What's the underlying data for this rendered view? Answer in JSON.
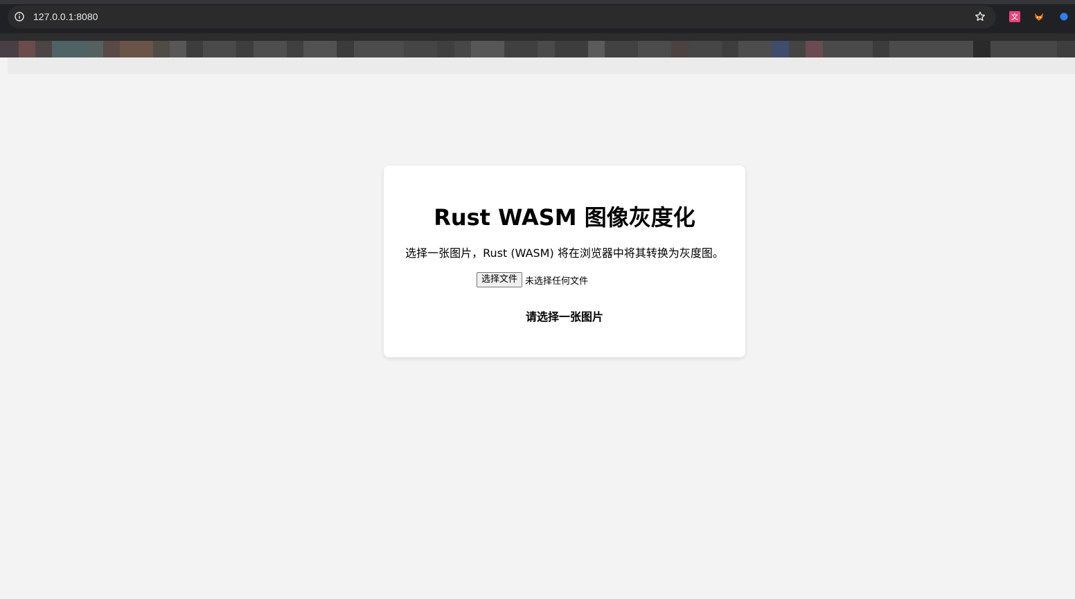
{
  "browser": {
    "url": "127.0.0.1:8080",
    "icons": {
      "site_info": "info-icon",
      "bookmark": "star-icon",
      "extension_1": "translate-icon",
      "extension_2": "fox-icon",
      "extension_3": "blue-dot-icon"
    },
    "colors": {
      "toolbar_background": "#202124",
      "address_bar": "#2b2b2b",
      "page_background": "#f3f3f3",
      "card_background": "#ffffff"
    }
  },
  "card": {
    "title": "Rust WASM 图像灰度化",
    "description": "选择一张图片，Rust (WASM) 将在浏览器中将其转换为灰度图。",
    "file_input": {
      "button_label": "选择文件",
      "status": "未选择任何文件"
    },
    "status_message": "请选择一张图片"
  }
}
